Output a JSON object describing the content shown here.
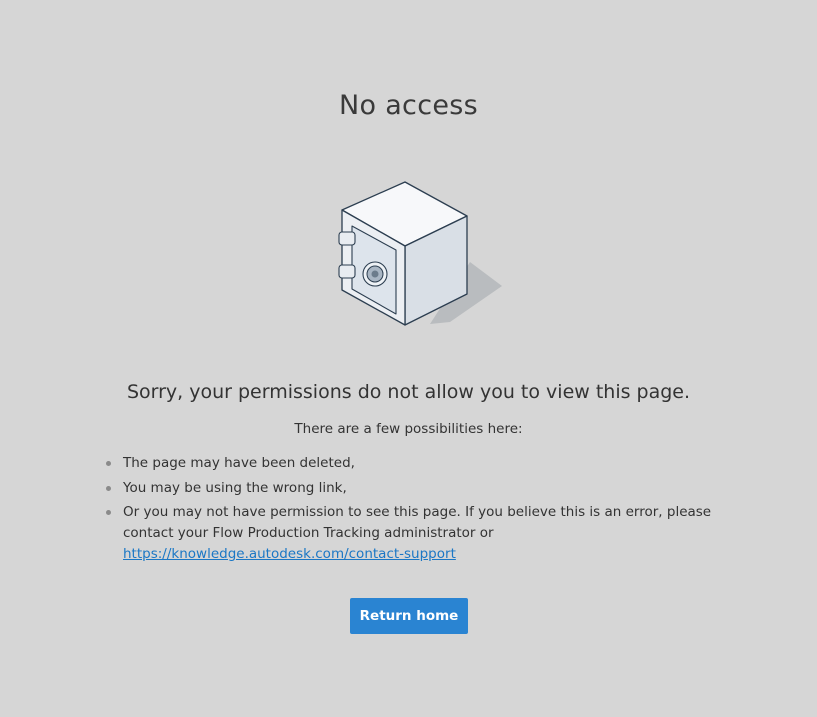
{
  "page": {
    "title": "No access",
    "headline": "Sorry, your permissions do not allow you to view this page.",
    "subline": "There are a few possibilities here:",
    "reasons": [
      "The page may have been deleted,",
      "You may be using the wrong link,",
      "Or you may not have permission to see this page. If you believe this is an error, please contact your Flow Production Tracking administrator or"
    ],
    "support_link": "https://knowledge.autodesk.com/contact-support",
    "return_button": "Return home"
  },
  "illustration": {
    "icon": "safe-icon"
  },
  "colors": {
    "background": "#d6d6d6",
    "button": "#2a84d2",
    "link": "#1b77c5"
  }
}
